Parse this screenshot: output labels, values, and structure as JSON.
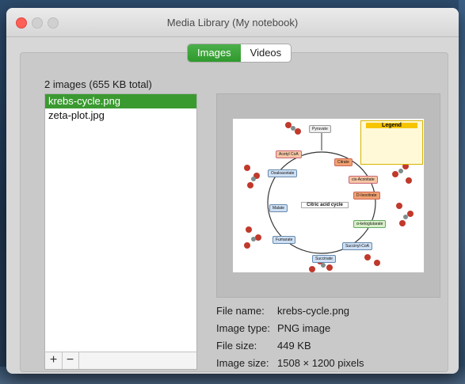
{
  "window": {
    "title": "Media Library (My notebook)"
  },
  "tabs": {
    "images": "Images",
    "videos": "Videos"
  },
  "library": {
    "count_text": "2 images (655 KB total)",
    "files": [
      "krebs-cycle.png",
      "zeta-plot.jpg"
    ],
    "add_label": "+",
    "remove_label": "−"
  },
  "preview": {
    "diagram": {
      "center_title": "Citric acid cycle",
      "legend_title": "Legend",
      "labels": [
        "Pyruvate",
        "Acetyl CoA",
        "Citrate",
        "cis-Aconitate",
        "D-Isocitrate",
        "α-ketoglutarate",
        "Succinyl-CoA",
        "Succinate",
        "Fumarate",
        "Malate",
        "Oxaloacetate"
      ]
    }
  },
  "details": {
    "file_name_label": "File name:",
    "file_name": "krebs-cycle.png",
    "image_type_label": "Image type:",
    "image_type": "PNG image",
    "file_size_label": "File size:",
    "file_size": "449 KB",
    "image_size_label": "Image size:",
    "image_size": "1508 × 1200 pixels"
  },
  "colors": {
    "accent": "#3a9a2f",
    "close": "#fe5f57"
  }
}
